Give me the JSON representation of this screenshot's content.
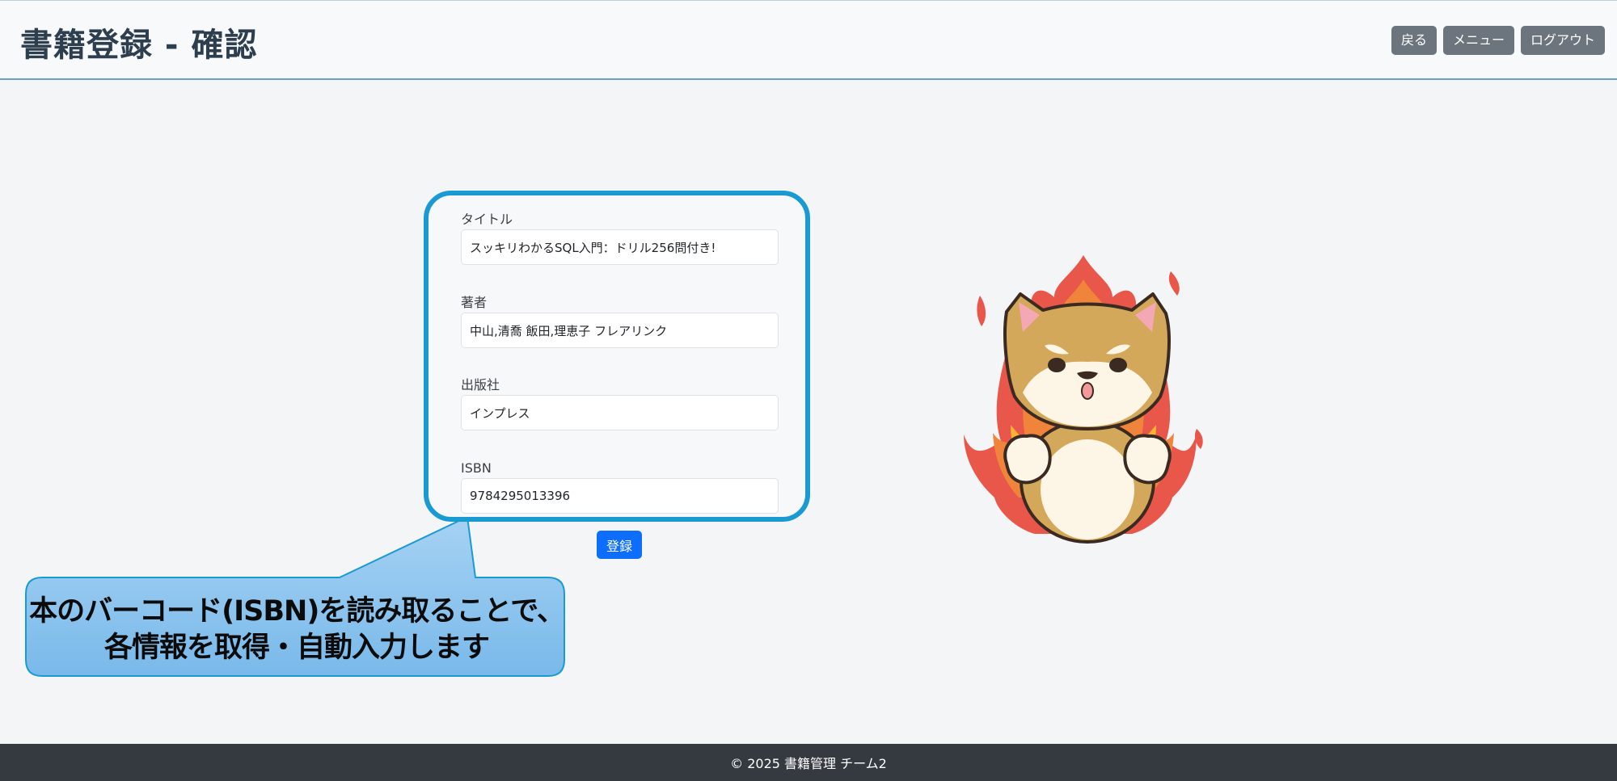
{
  "header": {
    "title": "書籍登録 - 確認",
    "buttons": {
      "back": "戻る",
      "menu": "メニュー",
      "logout": "ログアウト"
    }
  },
  "form": {
    "fields": [
      {
        "label": "タイトル",
        "value": "スッキリわかるSQL入門：ドリル256問付き!"
      },
      {
        "label": "著者",
        "value": "中山,清喬 飯田,理恵子 フレアリンク"
      },
      {
        "label": "出版社",
        "value": "インプレス"
      },
      {
        "label": "ISBN",
        "value": "9784295013396"
      }
    ],
    "submit_label": "登録"
  },
  "callout": {
    "line1": "本のバーコード(ISBN)を読み取ることで、",
    "line2": "各情報を取得・自動入力します"
  },
  "mascot": {
    "icon": "angry-shiba-dog-flames-illustration"
  },
  "footer": {
    "text": "© 2025 書籍管理 チーム2"
  },
  "colors": {
    "accent_border": "#1a9ad3",
    "primary_button": "#0d6efd",
    "secondary_button": "#6c757d",
    "footer_bg": "#343a40",
    "callout_fill": "#8fc6ee"
  }
}
